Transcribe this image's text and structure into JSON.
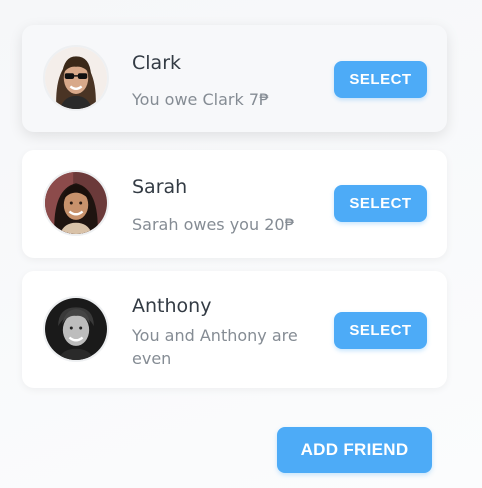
{
  "friends": [
    {
      "name": "Clark",
      "status": "You owe Clark 7₱",
      "status_color": "#858c94",
      "selected": true,
      "avatar_icon": "avatar-clark-photo",
      "select_label": "SELECT"
    },
    {
      "name": "Sarah",
      "status": "Sarah owes you 20₱",
      "status_color": "#858c94",
      "selected": false,
      "avatar_icon": "avatar-sarah-photo",
      "select_label": "SELECT"
    },
    {
      "name": "Anthony",
      "status": "You and Anthony are even",
      "status_color": "#858c94",
      "selected": false,
      "avatar_icon": "avatar-anthony-photo",
      "select_label": "SELECT"
    }
  ],
  "add_friend_label": "ADD FRIEND",
  "colors": {
    "accent": "#4dabf7",
    "name_text": "#333b44",
    "muted_text": "#858c94"
  }
}
